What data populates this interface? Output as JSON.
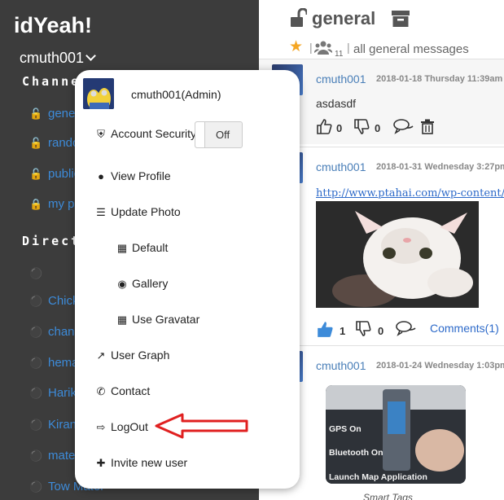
{
  "app": {
    "title": "idYeah!"
  },
  "user": {
    "name": "cmuth001"
  },
  "sidebar": {
    "channels_heading": "Channels",
    "channels": [
      {
        "label": "general",
        "icon": "unlock-icon"
      },
      {
        "label": "random",
        "icon": "unlock-icon"
      },
      {
        "label": "public",
        "icon": "unlock-icon"
      },
      {
        "label": "my private",
        "icon": "lock-icon"
      }
    ],
    "direct_heading": "DirectMessages",
    "direct": [
      {
        "label": "",
        "icon": "user-circle-icon"
      },
      {
        "label": "Chicken",
        "icon": "user-circle-icon"
      },
      {
        "label": "chandu",
        "icon": "user-circle-icon"
      },
      {
        "label": "hemanth",
        "icon": "user-circle-icon"
      },
      {
        "label": "Harika",
        "icon": "user-circle-icon"
      },
      {
        "label": "Kiran",
        "icon": "user-circle-icon"
      },
      {
        "label": "mate",
        "icon": "user-circle-icon"
      },
      {
        "label": "Tow Mater",
        "icon": "user-circle-icon"
      }
    ]
  },
  "header": {
    "channel_name": "general",
    "member_count": "11",
    "description": "all general messages",
    "separator": "|"
  },
  "messages": [
    {
      "author": "cmuth001",
      "time": "2018-01-18 Thursday 11:39am",
      "text": "asdasdf",
      "likes": "0",
      "dislikes": "0"
    },
    {
      "author": "cmuth001",
      "time": "2018-01-31 Wednesday 3:27pm",
      "link": "http://www.ptahai.com/wp-content/",
      "likes": "1",
      "dislikes": "0",
      "comments": "Comments(1)"
    },
    {
      "author": "cmuth001",
      "time": "2018-01-24 Wednesday 1:03pm",
      "image_labels": [
        "GPS On",
        "Bluetooth On",
        "Launch Map Application"
      ],
      "caption": "Smart Tags"
    }
  ],
  "dropdown": {
    "username": "cmuth001(Admin)",
    "items": {
      "account_security": "Account Security",
      "toggle_state": "Off",
      "view_profile": "View Profile",
      "update_photo": "Update Photo",
      "default": "Default",
      "gallery": "Gallery",
      "use_gravatar": "Use Gravatar",
      "user_graph": "User Graph",
      "contact": "Contact",
      "logout": "LogOut",
      "invite": "Invite new user"
    }
  },
  "colors": {
    "sidebar_bg": "#3c3c3c",
    "link": "#3d8bd9",
    "star": "#f5a623",
    "arrow": "#e02020"
  }
}
